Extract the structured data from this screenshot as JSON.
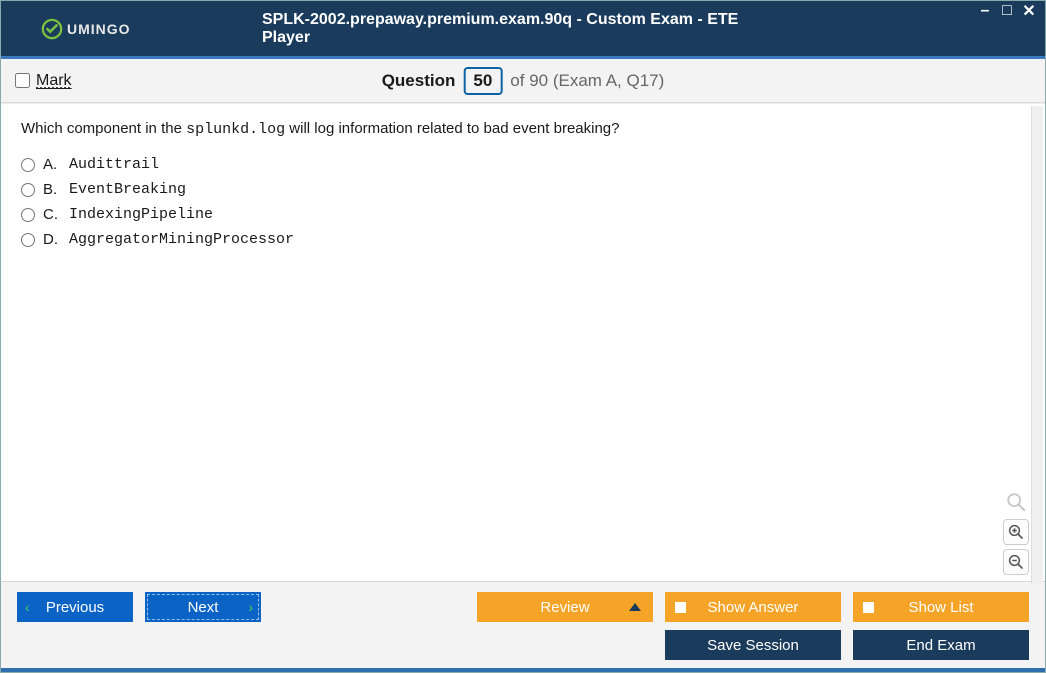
{
  "window": {
    "title": "SPLK-2002.prepaway.premium.exam.90q - Custom Exam - ETE Player",
    "brand": "UMINGO"
  },
  "subbar": {
    "mark_label": "Mark",
    "question_word": "Question",
    "question_number": "50",
    "of_text": "of 90 (Exam A, Q17)"
  },
  "question": {
    "prefix": "Which component in the ",
    "code": "splunkd.log",
    "suffix": " will log information related to bad event breaking?",
    "options": [
      {
        "letter": "A.",
        "value": "Audittrail"
      },
      {
        "letter": "B.",
        "value": "EventBreaking"
      },
      {
        "letter": "C.",
        "value": "IndexingPipeline"
      },
      {
        "letter": "D.",
        "value": "AggregatorMiningProcessor"
      }
    ]
  },
  "buttons": {
    "previous": "Previous",
    "next": "Next",
    "review": "Review",
    "show_answer": "Show Answer",
    "show_list": "Show List",
    "save_session": "Save Session",
    "end_exam": "End Exam"
  }
}
